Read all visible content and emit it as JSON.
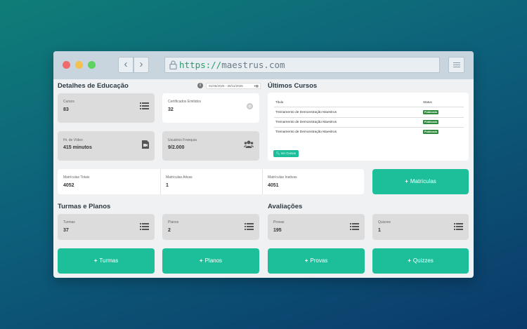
{
  "browser": {
    "url_scheme": "https://",
    "url_host": "maestrus.com"
  },
  "education": {
    "title": "Detalhes de Educação",
    "date_range": "01/05/2025 - 30/11/2025",
    "cards": [
      {
        "label": "Cursos",
        "value": "83",
        "icon": "list-icon"
      },
      {
        "label": "Certificados Emitidos",
        "value": "32",
        "icon": "certificate-icon"
      },
      {
        "label": "Hr. de Vídeo",
        "value": "415 minutos",
        "icon": "video-file-icon"
      },
      {
        "label": "Usuários Franquia",
        "value": "9/2.000",
        "icon": "users-icon"
      }
    ]
  },
  "courses": {
    "title": "Últimos Cursos",
    "col_title": "Título",
    "col_status": "Status",
    "rows": [
      {
        "title": "Treinamento de Demonstração Maestrus",
        "status": "Publicado"
      },
      {
        "title": "Treinamento de Demonstração Maestrus",
        "status": "Publicado"
      },
      {
        "title": "Treinamento de Demonstração Maestrus",
        "status": "Publicado"
      }
    ],
    "button": "Ver Cursos"
  },
  "enrollments": {
    "stats": [
      {
        "label": "Matrículas Totais",
        "value": "4052"
      },
      {
        "label": "Matrículas Ativas",
        "value": "1"
      },
      {
        "label": "Matrículas Inativas",
        "value": "4051"
      }
    ],
    "button": "Matrículas"
  },
  "groups": {
    "title": "Turmas e Planos",
    "cards": [
      {
        "label": "Turmas",
        "value": "37",
        "icon": "list-icon"
      },
      {
        "label": "Planos",
        "value": "2",
        "icon": "list-icon"
      }
    ],
    "buttons": [
      "Turmas",
      "Planos"
    ]
  },
  "assessments": {
    "title": "Avaliações",
    "cards": [
      {
        "label": "Provas",
        "value": "195",
        "icon": "list-icon"
      },
      {
        "label": "Quizzes",
        "value": "1",
        "icon": "list-icon"
      }
    ],
    "buttons": [
      "Provas",
      "Quizzes"
    ]
  },
  "colors": {
    "accent": "#1cbf9a",
    "published_badge": "#2e8b3d"
  }
}
